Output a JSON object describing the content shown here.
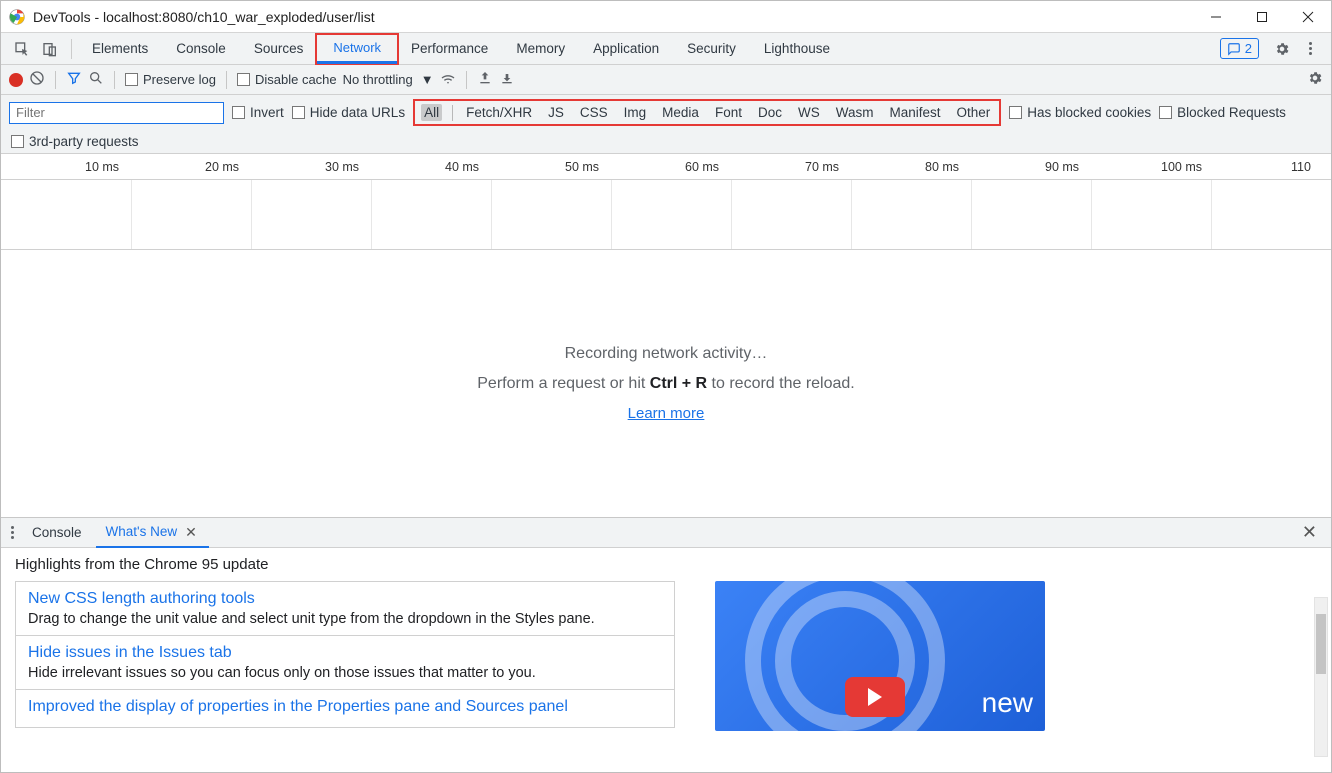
{
  "window": {
    "title": "DevTools - localhost:8080/ch10_war_exploded/user/list"
  },
  "tabs": {
    "items": [
      "Elements",
      "Console",
      "Sources",
      "Network",
      "Performance",
      "Memory",
      "Application",
      "Security",
      "Lighthouse"
    ],
    "active_index": 3,
    "issues_count": "2"
  },
  "toolbar": {
    "preserve_log": "Preserve log",
    "disable_cache": "Disable cache",
    "throttling": "No throttling"
  },
  "filter": {
    "placeholder": "Filter",
    "invert": "Invert",
    "hide_data_urls": "Hide data URLs",
    "types": [
      "All",
      "Fetch/XHR",
      "JS",
      "CSS",
      "Img",
      "Media",
      "Font",
      "Doc",
      "WS",
      "Wasm",
      "Manifest",
      "Other"
    ],
    "active_type_index": 0,
    "has_blocked_cookies": "Has blocked cookies",
    "blocked_requests": "Blocked Requests",
    "third_party": "3rd-party requests"
  },
  "timeline": {
    "ticks": [
      "10 ms",
      "20 ms",
      "30 ms",
      "40 ms",
      "50 ms",
      "60 ms",
      "70 ms",
      "80 ms",
      "90 ms",
      "100 ms",
      "110"
    ]
  },
  "empty": {
    "line1": "Recording network activity…",
    "line2a": "Perform a request or hit ",
    "kbd": "Ctrl + R",
    "line2b": " to record the reload.",
    "learn_more": "Learn more"
  },
  "drawer": {
    "tabs": [
      "Console",
      "What's New"
    ],
    "active_index": 1,
    "subtitle": "Highlights from the Chrome 95 update",
    "cards": [
      {
        "title": "New CSS length authoring tools",
        "desc": "Drag to change the unit value and select unit type from the dropdown in the Styles pane."
      },
      {
        "title": "Hide issues in the Issues tab",
        "desc": "Hide irrelevant issues so you can focus only on those issues that matter to you."
      },
      {
        "title": "Improved the display of properties in the Properties pane and Sources panel",
        "desc": ""
      }
    ],
    "promo_text": "new"
  }
}
